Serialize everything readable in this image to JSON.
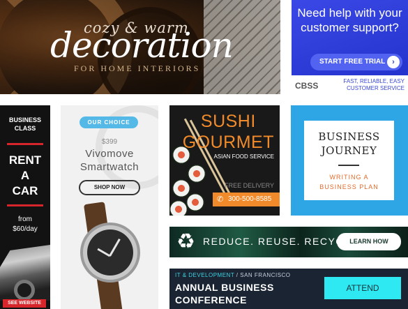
{
  "decoration": {
    "small": "cozy & warm",
    "big": "decoration",
    "sub": "FOR HOME INTERIORS"
  },
  "cbss": {
    "title": "Need help with your customer support?",
    "cta": "START FREE TRIAL",
    "cta_arrow": "›",
    "logo": "CBSS",
    "tagline_1": "FAST, RELIABLE, EASY",
    "tagline_2": "CUSTOMER SERVICE",
    "brand_color": "#3b48e6"
  },
  "rent": {
    "top_1": "BUSINESS",
    "top_2": "CLASS",
    "big_1": "RENT",
    "big_2": "A",
    "big_3": "CAR",
    "from_1": "from",
    "from_2": "$60/day",
    "cta": "SEE WEBSITE",
    "accent": "#d6252b"
  },
  "watch": {
    "badge": "OUR CHOICE",
    "price": "$399",
    "name_1": "Vivomove",
    "name_2": "Smartwatch",
    "cta": "SHOP NOW"
  },
  "sushi": {
    "title_1": "SUSHI",
    "title_2": "GOURMET",
    "subtitle": "ASIAN FOOD SERVICE",
    "delivery": "FREE DELIVERY",
    "phone": "300-500-8585",
    "phone_icon": "phone-icon",
    "accent": "#f08a2a"
  },
  "journey": {
    "title_1": "BUSINESS",
    "title_2": "JOURNEY",
    "sub_1": "WRITING A",
    "sub_2": "BUSINESS PLAN",
    "accent": "#e36b2c"
  },
  "recycle": {
    "icon": "recycle-icon",
    "text": "REDUCE. REUSE. RECYCLE.",
    "cta": "LEARN HOW"
  },
  "conference": {
    "category": "IT & DEVELOPMENT",
    "location": "/ SAN FRANCISCO",
    "title_1": "ANNUAL BUSINESS",
    "title_2": "CONFERENCE",
    "cta": "ATTEND",
    "accent": "#2ee8f2"
  }
}
